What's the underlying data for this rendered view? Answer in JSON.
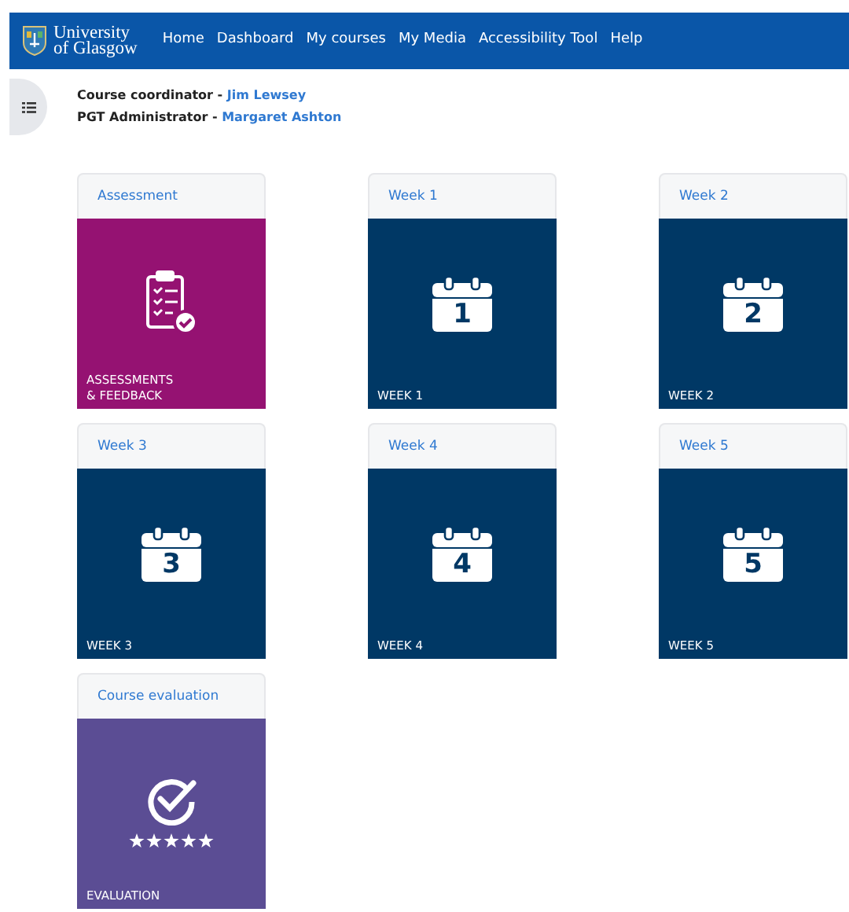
{
  "logo": {
    "lines": [
      "University",
      "of Glasgow"
    ]
  },
  "nav": [
    {
      "label": "Home"
    },
    {
      "label": "Dashboard"
    },
    {
      "label": "My courses"
    },
    {
      "label": "My Media"
    },
    {
      "label": "Accessibility Tool"
    },
    {
      "label": "Help"
    }
  ],
  "contacts": [
    {
      "role": "Course coordinator - ",
      "name": "Jim Lewsey"
    },
    {
      "role": "PGT Administrator - ",
      "name": "Margaret Ashton"
    }
  ],
  "tiles": [
    {
      "kind": "assessment",
      "title": "Assessment",
      "caption": [
        "ASSESSMENTS",
        "& FEEDBACK"
      ],
      "color": "#951272"
    },
    {
      "kind": "week",
      "title": "Week 1",
      "number": "1",
      "caption": [
        "WEEK 1"
      ],
      "color": "#003865"
    },
    {
      "kind": "week",
      "title": "Week 2",
      "number": "2",
      "caption": [
        "WEEK 2"
      ],
      "color": "#003865"
    },
    {
      "kind": "week",
      "title": "Week 3",
      "number": "3",
      "caption": [
        "WEEK 3"
      ],
      "color": "#003865"
    },
    {
      "kind": "week",
      "title": "Week 4",
      "number": "4",
      "caption": [
        "WEEK 4"
      ],
      "color": "#003865"
    },
    {
      "kind": "week",
      "title": "Week 5",
      "number": "5",
      "caption": [
        "WEEK 5"
      ],
      "color": "#003865"
    },
    {
      "kind": "evaluation",
      "title": "Course evaluation",
      "caption": [
        "EVALUATION"
      ],
      "color": "#5b4d94"
    }
  ]
}
